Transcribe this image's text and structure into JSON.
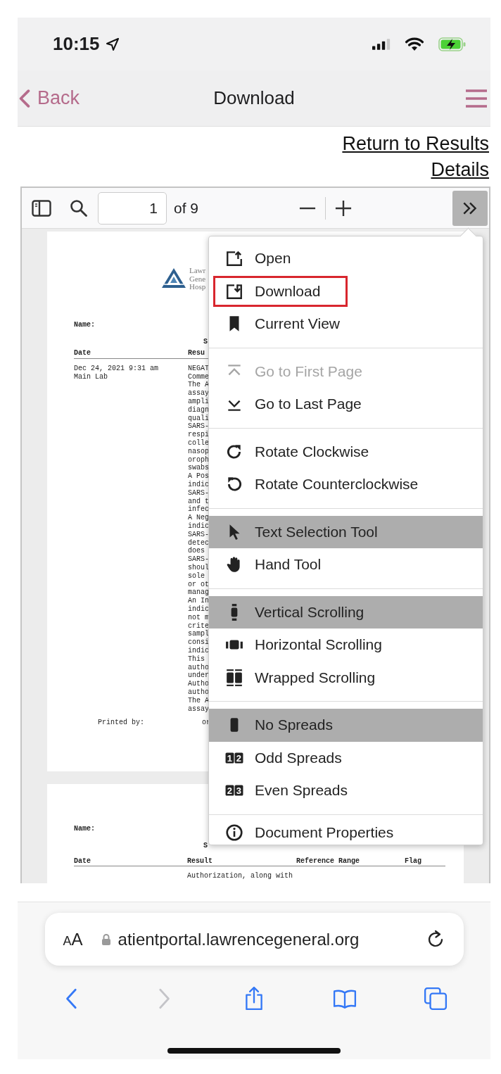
{
  "status_bar": {
    "time": "10:15"
  },
  "nav": {
    "back": "Back",
    "title": "Download"
  },
  "links": [
    "Return to Results",
    "Details"
  ],
  "pdf_toolbar": {
    "page": "1",
    "page_count": "of 9"
  },
  "page_one": {
    "logo_lines": [
      "Lawr",
      "Gene",
      "Hosp"
    ],
    "name_label": "Name:",
    "section_letter": "S",
    "columns": [
      "Date",
      "Resu"
    ],
    "date_lines": [
      "Dec 24, 2021 9:31 am",
      "Main Lab"
    ],
    "result_lines": [
      "NEGAT",
      "Comme",
      "The A",
      "assay",
      "ampli",
      "diagn",
      "quali",
      "SARS-",
      "respi",
      "colle",
      "nasop",
      "oroph",
      "swabs",
      "A Pos",
      "indic",
      "SARS-",
      "and t",
      "infec",
      "A Neg",
      "indic",
      "SARS-",
      "detec",
      "does",
      "SARS-",
      "shoul",
      "sole",
      "or ot",
      "manag",
      "An In",
      "indic",
      "not m",
      "crite",
      "sampl",
      "consi",
      "indic",
      "This",
      "autho",
      "under",
      "Autho",
      "autho",
      "The A",
      "assay"
    ],
    "footer": [
      "Printed by:",
      "or"
    ]
  },
  "page_two": {
    "name_label": "Name:",
    "section_letter": "S",
    "columns": [
      "Date",
      "Result",
      "Reference Range",
      "Flag"
    ],
    "result_line": "Authorization, along with"
  },
  "menu": {
    "groups": [
      {
        "items": [
          {
            "kind": "open",
            "label": "Open",
            "disabled": false,
            "selected": false,
            "outlined": false
          },
          {
            "kind": "download",
            "label": "Download",
            "disabled": false,
            "selected": false,
            "outlined": true
          },
          {
            "kind": "bookmark",
            "label": "Current View",
            "disabled": false,
            "selected": false,
            "outlined": false
          }
        ]
      },
      {
        "items": [
          {
            "kind": "first",
            "label": "Go to First Page",
            "disabled": true,
            "selected": false,
            "outlined": false
          },
          {
            "kind": "last",
            "label": "Go to Last Page",
            "disabled": false,
            "selected": false,
            "outlined": false
          }
        ]
      },
      {
        "items": [
          {
            "kind": "rotate-cw",
            "label": "Rotate Clockwise",
            "disabled": false,
            "selected": false,
            "outlined": false
          },
          {
            "kind": "rotate-ccw",
            "label": "Rotate Counterclockwise",
            "disabled": false,
            "selected": false,
            "outlined": false
          }
        ]
      },
      {
        "items": [
          {
            "kind": "pointer",
            "label": "Text Selection Tool",
            "disabled": false,
            "selected": true,
            "outlined": false
          },
          {
            "kind": "hand",
            "label": "Hand Tool",
            "disabled": false,
            "selected": false,
            "outlined": false
          }
        ]
      },
      {
        "items": [
          {
            "kind": "vertical",
            "label": "Vertical Scrolling",
            "disabled": false,
            "selected": true,
            "outlined": false
          },
          {
            "kind": "horizontal",
            "label": "Horizontal Scrolling",
            "disabled": false,
            "selected": false,
            "outlined": false
          },
          {
            "kind": "wrapped",
            "label": "Wrapped Scrolling",
            "disabled": false,
            "selected": false,
            "outlined": false
          }
        ]
      },
      {
        "items": [
          {
            "kind": "single",
            "label": "No Spreads",
            "disabled": false,
            "selected": true,
            "outlined": false
          },
          {
            "kind": "spread",
            "icon_text": "12",
            "label": "Odd Spreads",
            "disabled": false,
            "selected": false,
            "outlined": false
          },
          {
            "kind": "spread",
            "icon_text": "23",
            "label": "Even Spreads",
            "disabled": false,
            "selected": false,
            "outlined": false
          }
        ]
      },
      {
        "items": [
          {
            "kind": "info",
            "label": "Document Properties",
            "disabled": false,
            "selected": false,
            "outlined": false
          }
        ]
      }
    ]
  },
  "address_bar": {
    "text_size": "AA",
    "url": "atientportal.lawrencegeneral.org"
  },
  "browser_toolbar": [
    {
      "kind": "back",
      "disabled": false
    },
    {
      "kind": "forward",
      "disabled": true
    },
    {
      "kind": "share",
      "disabled": false
    },
    {
      "kind": "bookmarks",
      "disabled": false
    },
    {
      "kind": "tabs",
      "disabled": false
    }
  ]
}
